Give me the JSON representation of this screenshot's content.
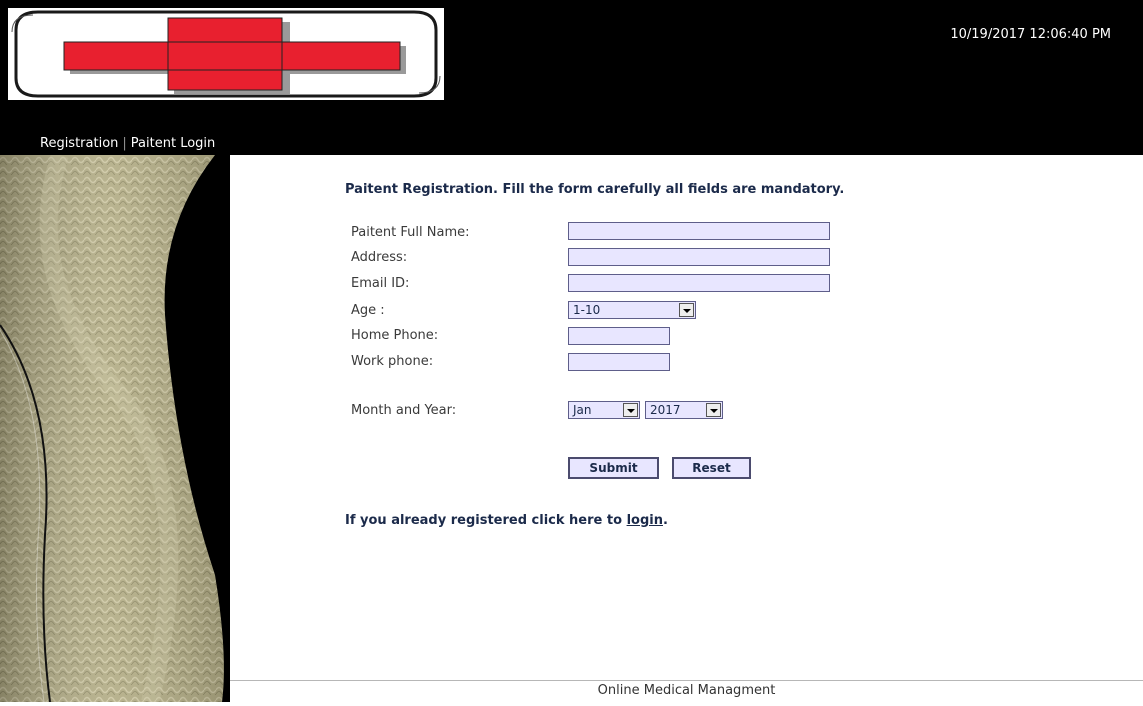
{
  "header": {
    "datetime": "10/19/2017 12:06:40 PM",
    "logo": "red-cross-logo"
  },
  "nav": {
    "registration": "Registration",
    "separator": "|",
    "patient_login": "Paitent Login"
  },
  "form": {
    "title": "Paitent Registration. Fill the form carefully all fields are mandatory.",
    "full_name_label": "Paitent Full Name:",
    "full_name_value": "",
    "address_label": "Address:",
    "address_value": "",
    "email_label": "Email ID:",
    "email_value": "",
    "age_label": "Age :",
    "age_selected": "1-10",
    "home_phone_label": "Home Phone:",
    "home_phone_value": "",
    "work_phone_label": "Work phone:",
    "work_phone_value": "",
    "month_year_label": "Month and Year:",
    "month_selected": "Jan",
    "year_selected": "2017",
    "submit_label": "Submit",
    "reset_label": "Reset",
    "login_prompt": "If you already registered click here to ",
    "login_link": "login",
    "login_suffix": "."
  },
  "footer": {
    "text": "Online Medical Managment"
  },
  "colors": {
    "header_bg": "#000000",
    "input_bg": "#e8e6ff",
    "cross_red": "#e8202f",
    "text_dark": "#1b2a4a"
  }
}
